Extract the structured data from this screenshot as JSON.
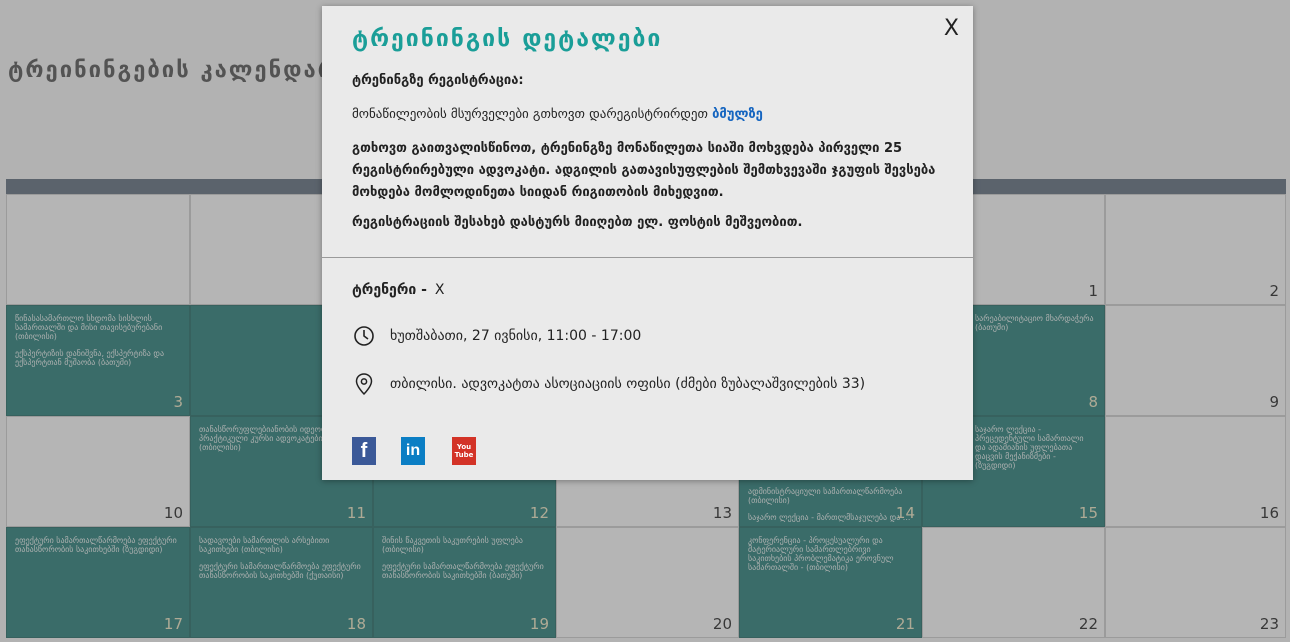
{
  "page": {
    "title": "ტრეინინგების კალენდარი"
  },
  "calendar": {
    "cells": [
      {
        "day": "1"
      },
      {
        "day": "2"
      },
      {
        "day": "3",
        "events": [
          "წინასასამართლო სხდომა სისხლის სამართალში და მისი თავისებურებანი (თბილისი)",
          "ექსპერტიზის დანიშვნა, ექსპერტიზა და ექსპერტთან მუშაობა (ბათუმი)"
        ]
      },
      {
        "day": "8",
        "events": [
          "სარეაბილიტაციო მხარდაჭერა (ბათუმი)"
        ]
      },
      {
        "day": "9"
      },
      {
        "day": "10"
      },
      {
        "day": "11",
        "events": [
          "თანასწორუფლებიანობის იდეოლოგია: პრაქტიკული კურსი ადვოკატებისთვის (თბილისი)"
        ]
      },
      {
        "day": "12"
      },
      {
        "day": "13"
      },
      {
        "day": "14",
        "events": [
          "ადმინისტრაციული სამართალწარმოება (თბილისი)",
          "საჯარო ლექცია - მართლმსაჯულება და ..."
        ]
      },
      {
        "day": "15",
        "events": [
          "საჯარო ლექცია - პრეცედენტული სამართალი და ადამიანის უფლებათა დაცვის მექანიზმები - (ზუგდიდი)"
        ]
      },
      {
        "day": "16"
      },
      {
        "day": "17",
        "events": [
          "ეფექტური სამართალწარმოება ეფექტური თანასწორობის საკითხებში (ზუგდიდი)"
        ]
      },
      {
        "day": "18",
        "events": [
          "სადავოები სამართლის არსებითი საკითხები (თბილისი)",
          "ეფექტური სამართალწარმოება ეფექტური თანასწორობის საკითხებში (ქუთაისი)"
        ]
      },
      {
        "day": "19",
        "events": [
          "შინის წაკვეთის საკუთრების უფლება (თბილისი)",
          "ეფექტური სამართალწარმოება ეფექტური თანასწორობის საკითხებში (ბათუმი)"
        ]
      },
      {
        "day": "20"
      },
      {
        "day": "21",
        "events": [
          "კონფერენცია - პროცესუალური და მატერიალური სამართლებრივი საკითხების პრობლემატიკა ეროვნულ სამართალში - (თბილისი)"
        ]
      },
      {
        "day": "22"
      },
      {
        "day": "23"
      }
    ]
  },
  "modal": {
    "title": "ტრეინინგის დეტალები",
    "close_label": "X",
    "registration_heading": "ტრენინგზე რეგისტრაცია:",
    "registration_text": "მონაწილეობის მსურველები გთხოვთ  დარეგისტრირდეთ",
    "registration_link": "ბმულზე",
    "notice": "გთხოვთ გაითვალისწინოთ, ტრენინგზე მონაწილეთა სიაში მოხვდება პირველი 25 რეგისტრირებული ადვოკატი. ადგილის გათავისუფლების შემთხვევაში ჯგუფის შევსება მოხდება მომლოდინეთა სიიდან რიგითობის მიხედვით.",
    "confirmation": "რეგისტრაციის შესახებ დასტურს მიიღებთ ელ. ფოსტის მეშვეობით.",
    "trainer_label": "ტრენერი -",
    "trainer_value": "X",
    "date_time": "ხუთშაბათი, 27 ივნისი,  11:00 - 17:00",
    "location": "თბილისი. ადვოკატთა ასოციაციის ოფისი (ძმები ზუბალაშვილების 33)",
    "social": {
      "facebook": "f",
      "linkedin": "in",
      "youtube_top": "You",
      "youtube_bottom": "Tube"
    }
  },
  "colors": {
    "accent": "#1a9e98",
    "teal_cell": "#1f7a76",
    "link": "#1565c0"
  }
}
